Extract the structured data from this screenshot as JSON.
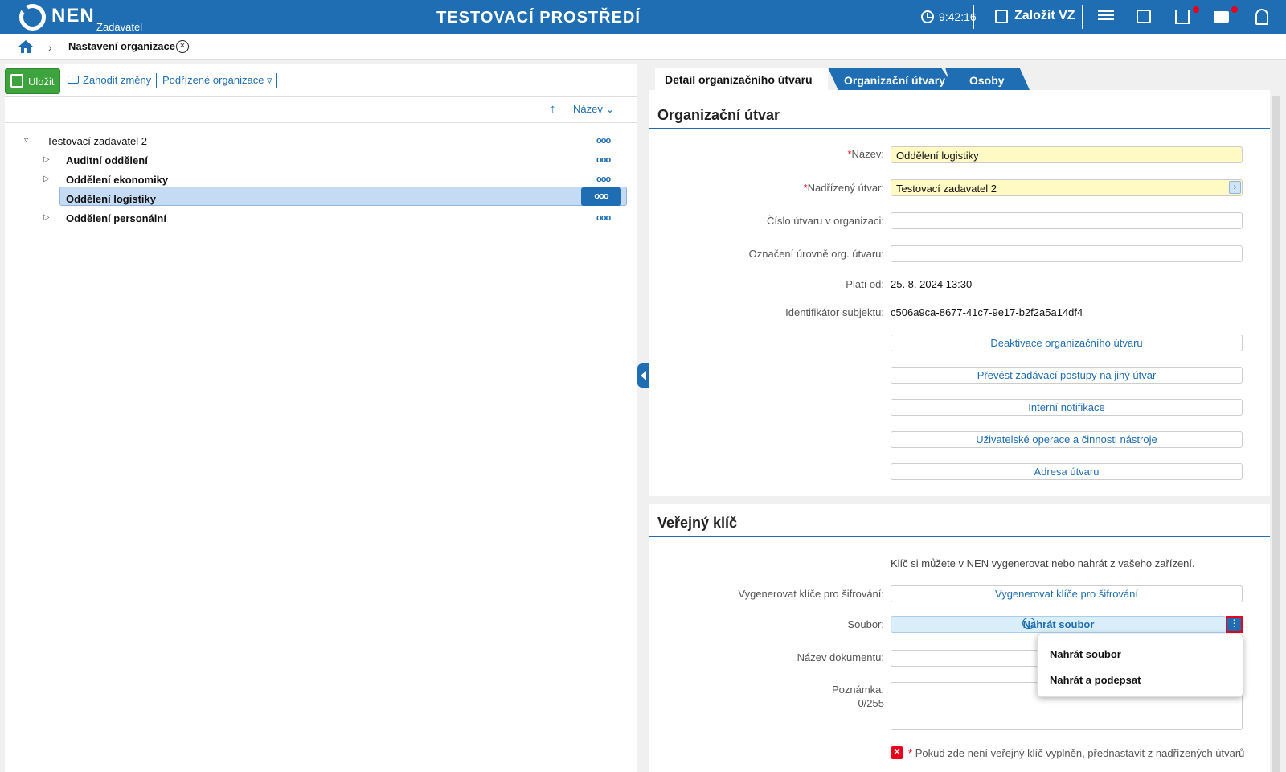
{
  "topbar": {
    "logo": "NEN",
    "logo_sub": "Zadavatel",
    "env_title": "TESTOVACÍ PROSTŘEDÍ",
    "clock": "9:42:16",
    "create_label": "Založit VZ",
    "icons": [
      "clock-icon",
      "edit-icon",
      "menu-icon",
      "calendar-icon",
      "download-icon",
      "mail-icon",
      "user-icon"
    ],
    "accent": "#1f6db2",
    "alert_color": "#e8001c"
  },
  "breadcrumb": {
    "current": "Nastavení organizace",
    "close_symbol": "×"
  },
  "left": {
    "save_label": "Uložit",
    "discard_label": "Zahodit změny",
    "subordinate_label": "Podřízené organizace ▿",
    "sort_label": "Název ⌄",
    "sort_arrow": "↑",
    "more_symbol": "ooo",
    "tree": [
      {
        "label": "Testovací zadavatel 2",
        "caret": "▿"
      },
      {
        "label": "Auditní oddělení",
        "caret": "▷"
      },
      {
        "label": "Oddělení ekonomiky",
        "caret": "▷"
      },
      {
        "label": "Oddělení logistiky",
        "caret": ""
      },
      {
        "label": "Oddělení personální",
        "caret": "▷"
      }
    ]
  },
  "tabs": {
    "detail": "Detail organizačního útvaru",
    "org_units": "Organizační útvary",
    "persons": "Osoby"
  },
  "org_unit": {
    "title": "Organizační útvar",
    "required_mark": "*",
    "name_label": "Název:",
    "name_value": "Oddělení logistiky",
    "parent_label": "Nadřízený útvar:",
    "parent_value": "Testovací zadavatel 2",
    "parent_btn": "›",
    "number_label": "Číslo útvaru v organizaci:",
    "level_label": "Označení úrovně org. útvaru:",
    "valid_from_label": "Platí od:",
    "valid_from_value": "25. 8. 2024 13:30",
    "subject_id_label": "Identifikátor subjektu:",
    "subject_id_value": "c506a9ca-8677-41c7-9e17-b2f2a5a14df4",
    "actions": [
      "Deaktivace organizačního útvaru",
      "Převést zadávací postupy na jiný útvar",
      "Interní notifikace",
      "Uživatelské operace a činnosti nástroje",
      "Adresa útvaru"
    ]
  },
  "public_key": {
    "title": "Veřejný klíč",
    "info": "Klíč si můžete v NEN vygenerovat nebo nahrát z vašeho zařízení.",
    "generate_label": "Vygenerovat klíče pro šifrování:",
    "generate_btn": "Vygenerovat klíče pro šifrování",
    "file_label": "Soubor:",
    "upload_btn": "Nahrát soubor",
    "kebab": "⋮",
    "doc_name_label": "Název dokumentu:",
    "note_label": "Poznámka:",
    "note_count": "0/255",
    "popup_items": [
      "Nahrát soubor",
      "Nahrát a podepsat"
    ],
    "error_icon": "✕",
    "error_text": "Pokud zde není veřejný klíč vyplněn, přednastavit z nadřízených útvarů"
  }
}
